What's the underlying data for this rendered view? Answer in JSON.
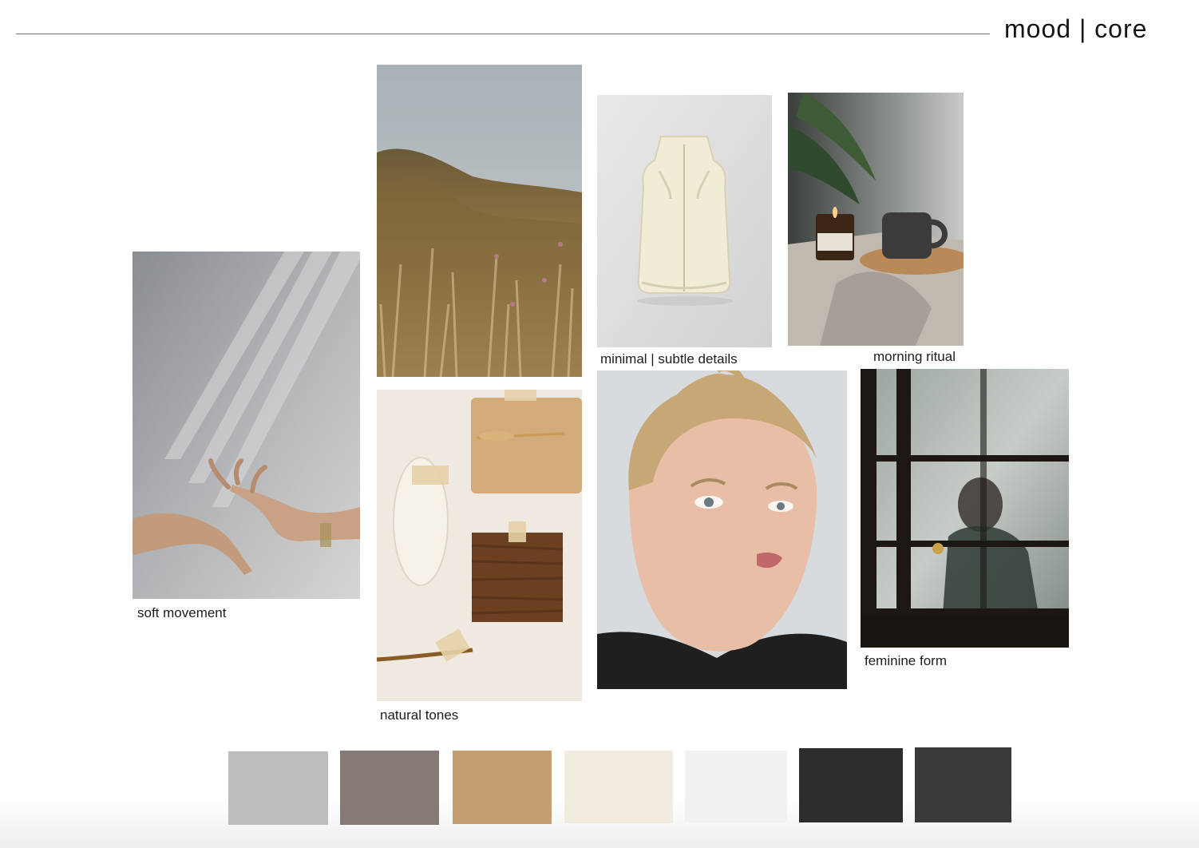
{
  "header": {
    "title": "mood | core"
  },
  "images": {
    "hands": {
      "icon": "hands-light-shadow-photo"
    },
    "grass": {
      "icon": "dry-grass-field-photo"
    },
    "vest": {
      "icon": "cream-puffer-vest-photo"
    },
    "candle": {
      "icon": "candle-and-mug-photo"
    },
    "textures": {
      "icon": "wood-paper-leaf-textures-photo"
    },
    "portrait": {
      "icon": "woman-portrait-photo"
    },
    "window": {
      "icon": "figure-behind-frosted-glass-photo"
    }
  },
  "captions": {
    "soft_movement": "soft movement",
    "natural_tones": "natural tones",
    "minimal_details": "minimal | subtle details",
    "morning_ritual": "morning ritual",
    "feminine_form": "feminine form"
  },
  "palette": [
    {
      "name": "light-grey-melange",
      "color": "#bdbdbd"
    },
    {
      "name": "taupe-melange",
      "color": "#857a75"
    },
    {
      "name": "camel",
      "color": "#c4a070"
    },
    {
      "name": "cream",
      "color": "#f2ebdf"
    },
    {
      "name": "off-white",
      "color": "#f1f1f1"
    },
    {
      "name": "charcoal",
      "color": "#2e2c2d"
    },
    {
      "name": "dark-grey-melange",
      "color": "#37393b"
    }
  ]
}
